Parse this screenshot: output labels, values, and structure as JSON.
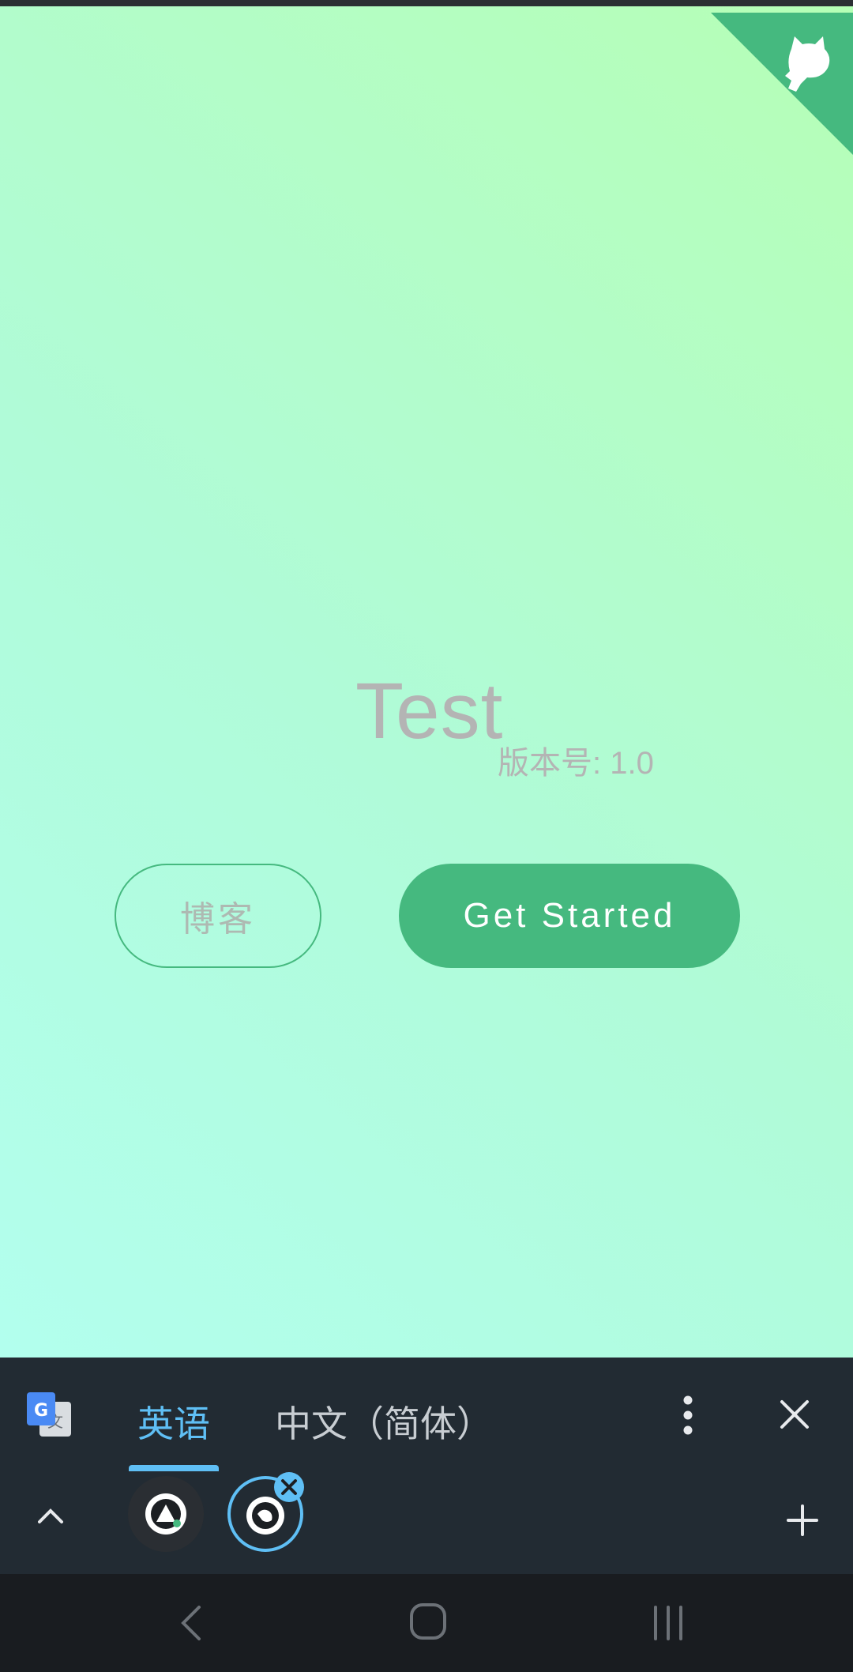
{
  "app": {
    "title": "Test",
    "version_label": "版本号: 1.0",
    "blog_button": "博客",
    "start_button": "Get Started",
    "accent": "#45b97f"
  },
  "translate_bar": {
    "source_language": "英语",
    "target_language": "中文（简体）",
    "active_color": "#5fbff5"
  },
  "icons": {
    "corner": "github-cat-icon",
    "translate": "google-translate-icon",
    "menu": "more-vert-icon",
    "close": "close-icon",
    "expand": "chevron-up-icon",
    "add": "plus-icon",
    "nav_back": "back-icon",
    "nav_home": "home-icon",
    "nav_recents": "recents-icon"
  }
}
